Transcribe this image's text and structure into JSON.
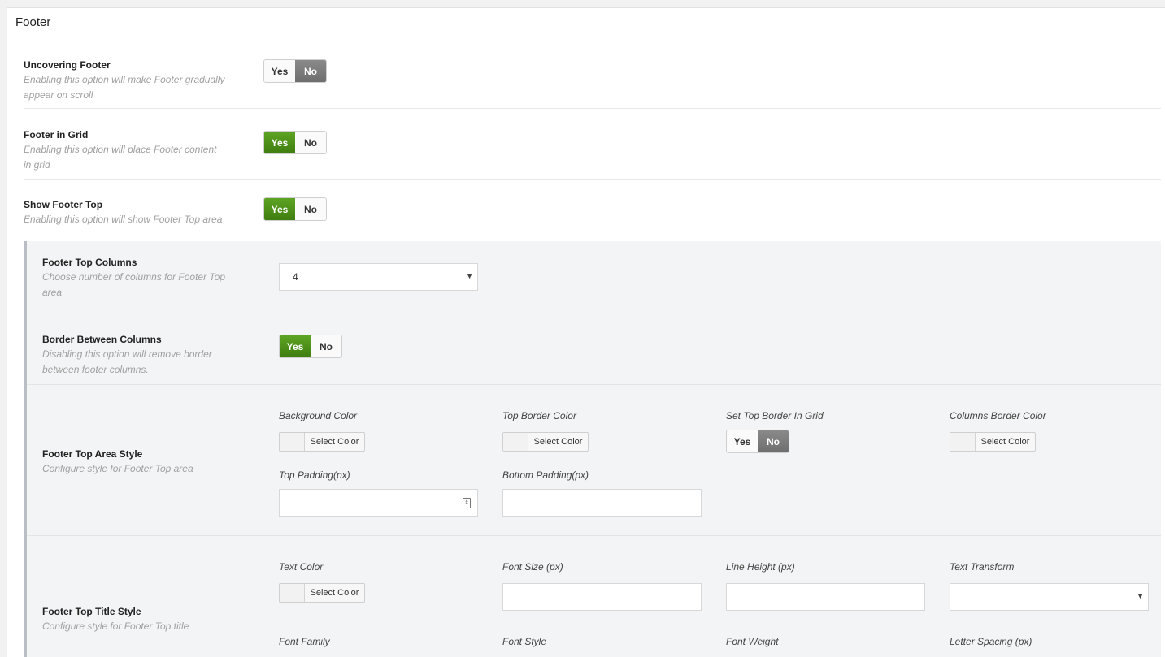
{
  "panel": {
    "title": "Footer"
  },
  "uncovering": {
    "title": "Uncovering Footer",
    "desc_line1": "Enabling this option will make Footer gradually",
    "desc_line2": "appear on scroll",
    "yes": "Yes",
    "no": "No",
    "value": "No"
  },
  "in_grid": {
    "title": "Footer in Grid",
    "desc_line1": "Enabling this option will place Footer content",
    "desc_line2": "in grid",
    "yes": "Yes",
    "no": "No",
    "value": "Yes"
  },
  "show_top": {
    "title": "Show Footer Top",
    "desc": "Enabling this option will show Footer Top area",
    "yes": "Yes",
    "no": "No",
    "value": "Yes"
  },
  "top_columns": {
    "title": "Footer Top Columns",
    "desc_line1": "Choose number of columns for Footer Top",
    "desc_line2": "area",
    "value": "4"
  },
  "border_columns": {
    "title": "Border Between Columns",
    "desc_line1": "Disabling this option will remove border",
    "desc_line2": "between footer columns.",
    "yes": "Yes",
    "no": "No",
    "value": "Yes"
  },
  "top_area_style": {
    "title": "Footer Top Area Style",
    "desc": "Configure style for Footer Top area",
    "background_color_label": "Background Color",
    "top_border_color_label": "Top Border Color",
    "set_top_border_label": "Set Top Border In Grid",
    "columns_border_color_label": "Columns Border Color",
    "select_color": "Select Color",
    "top_padding_label": "Top Padding(px)",
    "bottom_padding_label": "Bottom Padding(px)",
    "yes": "Yes",
    "no": "No",
    "set_top_border_value": "No"
  },
  "top_title_style": {
    "title": "Footer Top Title Style",
    "desc": "Configure style for Footer Top title",
    "text_color_label": "Text Color",
    "font_size_label": "Font Size (px)",
    "line_height_label": "Line Height (px)",
    "text_transform_label": "Text Transform",
    "select_color": "Select Color",
    "font_family_label": "Font Family",
    "font_style_label": "Font Style",
    "font_weight_label": "Font Weight",
    "letter_spacing_label": "Letter Spacing (px)"
  },
  "colors": {
    "accent_green": "#4e9419",
    "toggle_off_dark": "#7a7a7a"
  },
  "icons": {
    "select_arrow": "▼",
    "spinner": "⇕"
  }
}
